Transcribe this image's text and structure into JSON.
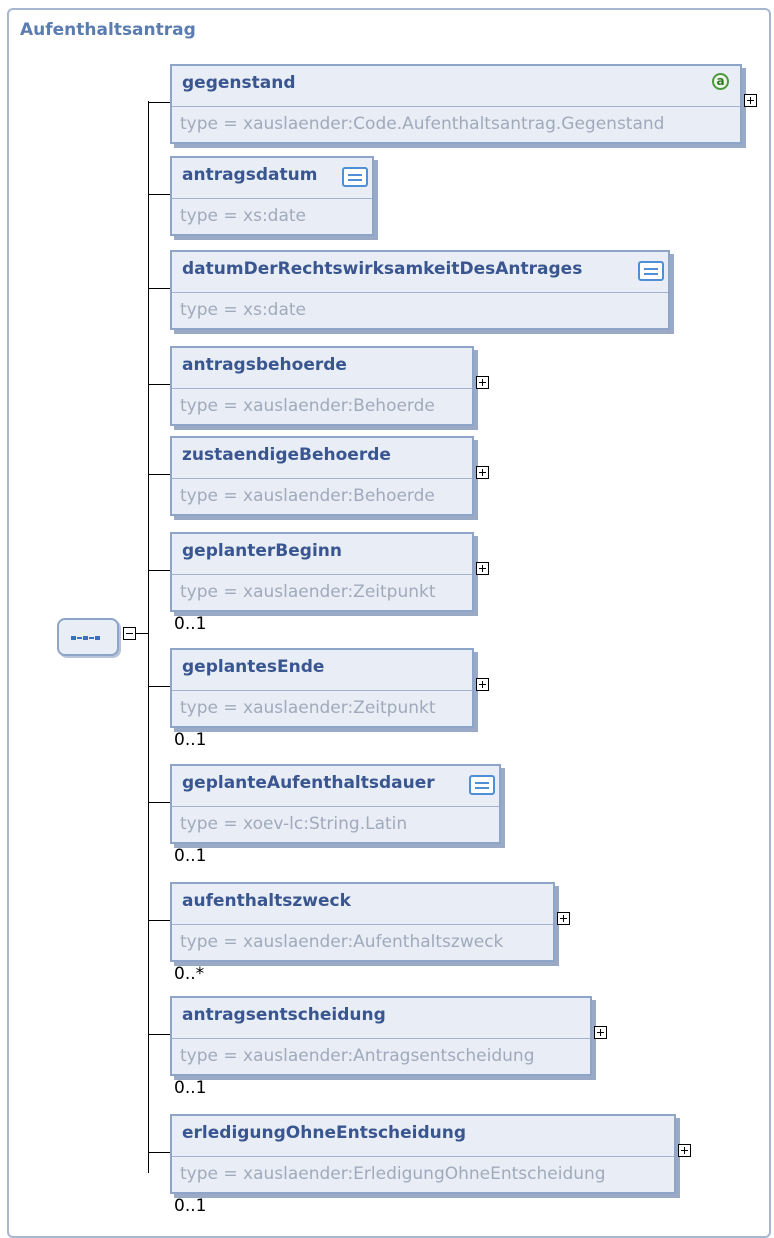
{
  "diagram": {
    "title": "Aufenthaltsantrag",
    "attribute_icon_text": "a",
    "elements": [
      {
        "name": "gegenstand",
        "type": "type = xauslaender:Code.Aufenthaltsantrag.Gegenstand",
        "cardinality": "",
        "expandable": true,
        "has_attribute_icon": true,
        "has_doc_icon": false
      },
      {
        "name": "antragsdatum",
        "type": "type = xs:date",
        "cardinality": "",
        "expandable": false,
        "has_attribute_icon": false,
        "has_doc_icon": true
      },
      {
        "name": "datumDerRechtswirksamkeitDesAntrages",
        "type": "type = xs:date",
        "cardinality": "",
        "expandable": false,
        "has_attribute_icon": false,
        "has_doc_icon": true
      },
      {
        "name": "antragsbehoerde",
        "type": "type = xauslaender:Behoerde",
        "cardinality": "",
        "expandable": true,
        "has_attribute_icon": false,
        "has_doc_icon": false
      },
      {
        "name": "zustaendigeBehoerde",
        "type": "type = xauslaender:Behoerde",
        "cardinality": "",
        "expandable": true,
        "has_attribute_icon": false,
        "has_doc_icon": false
      },
      {
        "name": "geplanterBeginn",
        "type": "type = xauslaender:Zeitpunkt",
        "cardinality": "0..1",
        "expandable": true,
        "has_attribute_icon": false,
        "has_doc_icon": false
      },
      {
        "name": "geplantesEnde",
        "type": "type = xauslaender:Zeitpunkt",
        "cardinality": "0..1",
        "expandable": true,
        "has_attribute_icon": false,
        "has_doc_icon": false
      },
      {
        "name": "geplanteAufenthaltsdauer",
        "type": "type = xoev-lc:String.Latin",
        "cardinality": "0..1",
        "expandable": false,
        "has_attribute_icon": false,
        "has_doc_icon": true
      },
      {
        "name": "aufenthaltszweck",
        "type": "type = xauslaender:Aufenthaltszweck",
        "cardinality": "0..*",
        "expandable": true,
        "has_attribute_icon": false,
        "has_doc_icon": false
      },
      {
        "name": "antragsentscheidung",
        "type": "type = xauslaender:Antragsentscheidung",
        "cardinality": "0..1",
        "expandable": true,
        "has_attribute_icon": false,
        "has_doc_icon": false
      },
      {
        "name": "erledigungOhneEntscheidung",
        "type": "type = xauslaender:ErledigungOhneEntscheidung",
        "cardinality": "0..1",
        "expandable": true,
        "has_attribute_icon": false,
        "has_doc_icon": false
      }
    ]
  }
}
